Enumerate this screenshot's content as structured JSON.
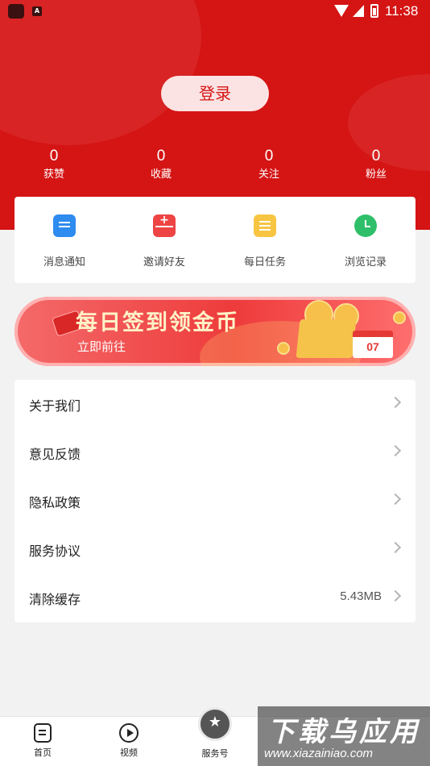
{
  "status_bar": {
    "time": "11:38",
    "app_icon_label": "A"
  },
  "header": {
    "login_label": "登录"
  },
  "stats": [
    {
      "value": "0",
      "label": "获赞"
    },
    {
      "value": "0",
      "label": "收藏"
    },
    {
      "value": "0",
      "label": "关注"
    },
    {
      "value": "0",
      "label": "粉丝"
    }
  ],
  "quick_actions": [
    {
      "label": "消息通知",
      "icon": "message-icon",
      "color": "#2e8cf0"
    },
    {
      "label": "邀请好友",
      "icon": "invite-envelope-icon",
      "color": "#ee4444"
    },
    {
      "label": "每日任务",
      "icon": "task-note-icon",
      "color": "#f7c542"
    },
    {
      "label": "浏览记录",
      "icon": "clock-icon",
      "color": "#2fbf6a"
    }
  ],
  "banner": {
    "title": "每日签到领金币",
    "subtitle": "立即前往",
    "calendar_day": "07"
  },
  "menu": [
    {
      "label": "关于我们",
      "value": ""
    },
    {
      "label": "意见反馈",
      "value": ""
    },
    {
      "label": "隐私政策",
      "value": ""
    },
    {
      "label": "服务协议",
      "value": ""
    },
    {
      "label": "清除缓存",
      "value": "5.43MB"
    }
  ],
  "tabbar": [
    {
      "label": "首页",
      "icon": "home-icon"
    },
    {
      "label": "视频",
      "icon": "play-icon"
    },
    {
      "label": "服务号",
      "icon": "service-icon"
    }
  ],
  "watermark": {
    "title": "下载乌应用",
    "url": "www.xiazainiao.com"
  },
  "colors": {
    "brand": "#d51414",
    "background": "#f2f2f2"
  }
}
